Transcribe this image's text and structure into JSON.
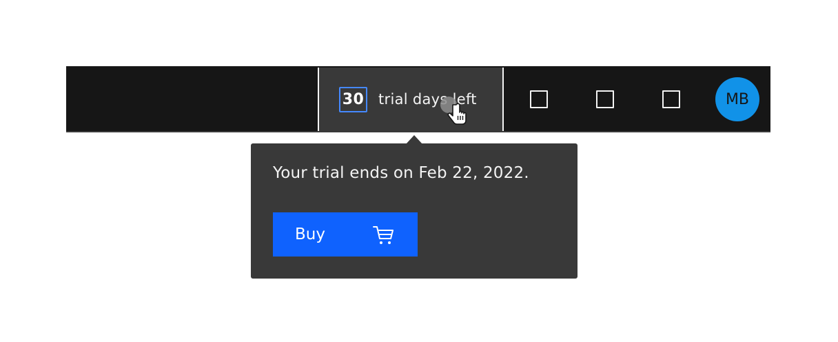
{
  "header": {
    "trial": {
      "days": "30",
      "label": "trial days left"
    },
    "actions": [
      {
        "icon": "square-icon"
      },
      {
        "icon": "square-icon"
      },
      {
        "icon": "square-icon"
      }
    ],
    "avatar": {
      "initials": "MB",
      "color": "#1192e8"
    }
  },
  "popover": {
    "message": "Your trial ends on Feb 22, 2022.",
    "buy_button": {
      "label": "Buy",
      "icon": "shopping-cart-icon"
    }
  },
  "colors": {
    "header_bg": "#161616",
    "trial_bg": "#393939",
    "badge_border": "#4589ff",
    "popover_bg": "#393939",
    "primary_button": "#0f62fe",
    "avatar_bg": "#1192e8"
  }
}
